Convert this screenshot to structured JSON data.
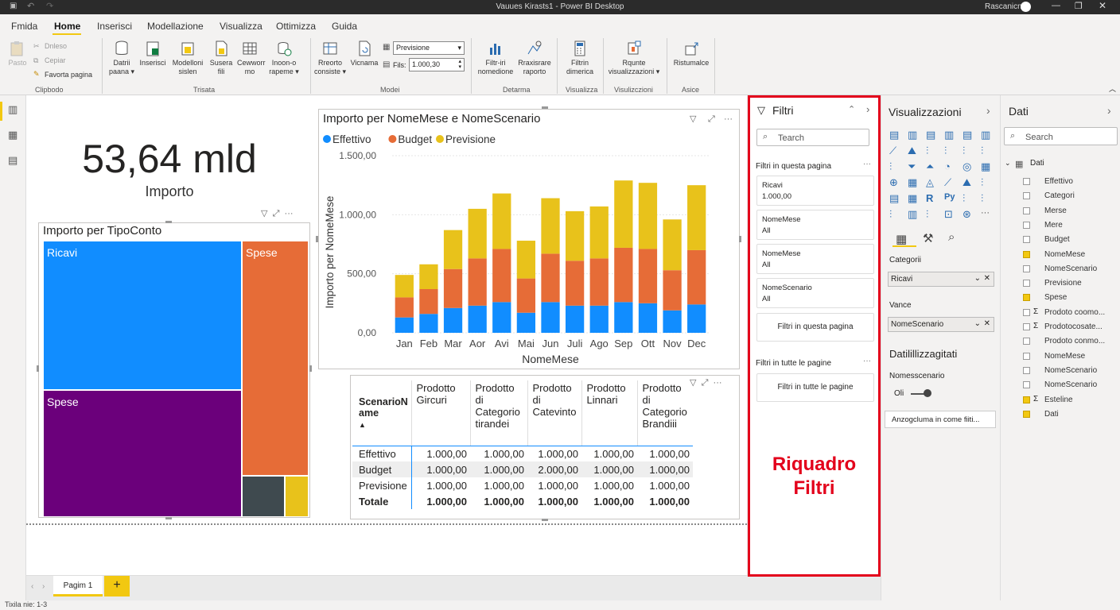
{
  "window": {
    "title": "Vauues Kirasts1 - Power BI Desktop",
    "user": "Rascanicn"
  },
  "ribbon": {
    "tabs": [
      "Fmida",
      "Home",
      "Inserisci",
      "Modellazione",
      "Visualizza",
      "Ottimizza",
      "Guida"
    ],
    "clipboard": {
      "paste": "Pasto",
      "cut": "Dnleso",
      "copy": "Cepiar",
      "format_painter": "Favorta pagina",
      "group": "Clipbodo"
    },
    "data_group": {
      "btn1": [
        "Datrii",
        "paana"
      ],
      "btn2": [
        "Inserisci",
        ""
      ],
      "btn3": [
        "Modelloni",
        "sislen"
      ],
      "btn4": [
        "Susera",
        "fili"
      ],
      "btn5": [
        "Cewworr",
        "mo"
      ],
      "btn6": [
        "Inoon-o",
        "rapeme"
      ],
      "group": "Trisata"
    },
    "model_group": {
      "btn1": [
        "Rreorto",
        "consiste"
      ],
      "btn2": [
        "Vicnama",
        ""
      ],
      "dropdown": "Previsione",
      "fils_label": "Fils:",
      "fils_value": "1.000,30",
      "group": "Modei"
    },
    "detarma": {
      "btn1": [
        "Filtr-iri",
        "nomedione"
      ],
      "btn2": [
        "Rraxisrare",
        "raporto"
      ],
      "group": "Detarma"
    },
    "visualizza": {
      "btn1": [
        "Filtrin",
        "dimerica"
      ],
      "group": "Visualizza"
    },
    "visualiz2": {
      "btn1": [
        "Rqunte",
        "visualizzazioni"
      ],
      "group": "Visulizczioni"
    },
    "asice": {
      "btn1": [
        "Ristumalce",
        ""
      ],
      "group": "Asice"
    }
  },
  "card": {
    "value": "53,64 mld",
    "label": "Importo"
  },
  "treemap": {
    "title": "Importo per TipoConto",
    "tiles": [
      {
        "label": "Ricavi",
        "color": "#118dff"
      },
      {
        "label": "Spese",
        "color": "#e66c37"
      },
      {
        "label": "Spese",
        "color": "#6b007b"
      },
      {
        "label": "",
        "color": "#3f4a4f"
      },
      {
        "label": "",
        "color": "#e8c21b"
      }
    ]
  },
  "chart_data": {
    "type": "bar",
    "stacked": true,
    "title": "Importo per NomeMese e NomeScenario",
    "xlabel": "NomeMese",
    "ylabel": "Importo per NomeMese",
    "ylim": [
      0,
      1500
    ],
    "yticks": [
      "0,00",
      "500,00",
      "1.000,00",
      "1.500,00"
    ],
    "legend_position": "top-left",
    "categories": [
      "Jan",
      "Feb",
      "Mar",
      "Aor",
      "Avi",
      "Mai",
      "Jun",
      "Juli",
      "Ago",
      "Sep",
      "Ott",
      "Nov",
      "Dec"
    ],
    "series": [
      {
        "name": "Effettivo",
        "color": "#118dff",
        "values": [
          130,
          160,
          210,
          230,
          260,
          170,
          260,
          230,
          230,
          260,
          250,
          190,
          240
        ]
      },
      {
        "name": "Budget",
        "color": "#e66c37",
        "values": [
          170,
          210,
          330,
          400,
          450,
          290,
          410,
          380,
          400,
          460,
          460,
          340,
          460
        ]
      },
      {
        "name": "Previsione",
        "color": "#e8c21b",
        "values": [
          190,
          210,
          330,
          420,
          470,
          320,
          470,
          420,
          440,
          570,
          560,
          430,
          550
        ]
      }
    ]
  },
  "matrix": {
    "corner": "ScenarioN ame",
    "headers": [
      "Prodotto Gircuri",
      "Prodotto di Categorio tirandei",
      "Prodotto di Catevinto",
      "Prodotto Linnari",
      "Prodotto di Categorio Brandiii"
    ],
    "rows": [
      {
        "label": "Effettivo",
        "values": [
          "1.000,00",
          "1.000,00",
          "1.000,00",
          "1.000,00",
          "1.000,00"
        ]
      },
      {
        "label": "Budget",
        "values": [
          "1.000,00",
          "1.000,00",
          "2.000,00",
          "1.000,00",
          "1.000,00"
        ]
      },
      {
        "label": "Previsione",
        "values": [
          "1.000,00",
          "1.000,00",
          "1.000,00",
          "1.000,00",
          "1.000,00"
        ]
      }
    ],
    "total": {
      "label": "Totale",
      "values": [
        "1.000,00",
        "1.000,00",
        "1.000,00",
        "1.000,00",
        "1.000,00"
      ]
    }
  },
  "filters": {
    "title": "Filtri",
    "search_placeholder": "Tearch",
    "page_section": "Filtri in questa pagina",
    "cards": [
      {
        "name": "Ricavi",
        "value": "1.000,00"
      },
      {
        "name": "NomeMese",
        "value": "All"
      },
      {
        "name": "NomeMese",
        "value": "All"
      },
      {
        "name": "NomeScenario",
        "value": "All"
      }
    ],
    "page_drop": "Filtri in questa pagina",
    "all_section": "Filtri in tutte le pagine",
    "all_drop": "Filtri in tutte le pagine",
    "annotation": [
      "Riquadro",
      "Filtri"
    ]
  },
  "visualizations": {
    "title": "Visualizzazioni",
    "categorie_label": "Categorii",
    "categorie_value": "Ricavi",
    "vance_label": "Vance",
    "vance_value": "NomeScenario",
    "section2": "Datilillizzagitati",
    "toggle_label": "Nomesscenario",
    "toggle_value": "Oli",
    "button": "Anzogcluma in come fiiti..."
  },
  "data_pane": {
    "title": "Dati",
    "search_placeholder": "Search",
    "table": "Dati",
    "fields": [
      {
        "name": "Effettivo",
        "checked": false,
        "sigma": false
      },
      {
        "name": "Categori",
        "checked": false,
        "sigma": false
      },
      {
        "name": "Merse",
        "checked": false,
        "sigma": false
      },
      {
        "name": "Mere",
        "checked": false,
        "sigma": false
      },
      {
        "name": "Budget",
        "checked": false,
        "sigma": false
      },
      {
        "name": "NomeMese",
        "checked": true,
        "sigma": false
      },
      {
        "name": "NomeScenario",
        "checked": false,
        "sigma": false
      },
      {
        "name": "Previsione",
        "checked": false,
        "sigma": false
      },
      {
        "name": "Spese",
        "checked": true,
        "sigma": false
      },
      {
        "name": "Prodoto coomo...",
        "checked": false,
        "sigma": true
      },
      {
        "name": "Prodotocosate...",
        "checked": false,
        "sigma": true
      },
      {
        "name": "Prodoto conmo...",
        "checked": false,
        "sigma": false
      },
      {
        "name": "NomeMese",
        "checked": false,
        "sigma": false
      },
      {
        "name": "NomeScenario",
        "checked": false,
        "sigma": false
      },
      {
        "name": "NomeScenario",
        "checked": false,
        "sigma": false
      },
      {
        "name": "Esteline",
        "checked": true,
        "sigma": true
      },
      {
        "name": "Dati",
        "checked": true,
        "sigma": false
      }
    ]
  },
  "pages": {
    "tabs": [
      "Pagim 1"
    ],
    "add": "+"
  },
  "status": {
    "text": "Tixila nie: 1-3"
  },
  "colors": {
    "accent": "#f2c811",
    "highlight": "#e3001b"
  }
}
